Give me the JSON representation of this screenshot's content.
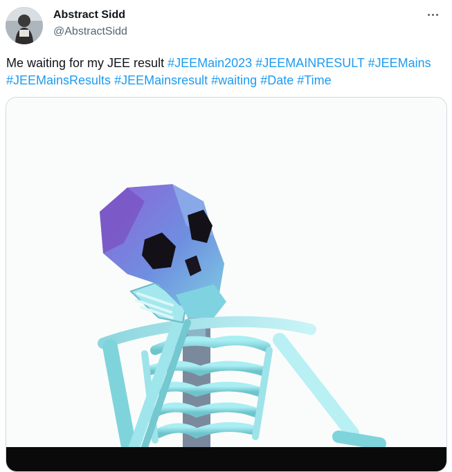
{
  "author": {
    "display_name": "Abstract Sidd",
    "handle": "@AbstractSidd"
  },
  "tweet": {
    "segments": [
      {
        "text": "Me waiting for my JEE result ",
        "type": "text"
      },
      {
        "text": "#JEEMain2023",
        "type": "hashtag"
      },
      {
        "text": " ",
        "type": "text"
      },
      {
        "text": "#JEEMAINRESULT",
        "type": "hashtag"
      },
      {
        "text": " ",
        "type": "text"
      },
      {
        "text": "#JEEMains",
        "type": "hashtag"
      },
      {
        "text": " ",
        "type": "text"
      },
      {
        "text": "#JEEMainsResults",
        "type": "hashtag"
      },
      {
        "text": " ",
        "type": "text"
      },
      {
        "text": "#JEEMainsresult",
        "type": "hashtag"
      },
      {
        "text": " ",
        "type": "text"
      },
      {
        "text": "#waiting",
        "type": "hashtag"
      },
      {
        "text": " ",
        "type": "text"
      },
      {
        "text": "#Date",
        "type": "hashtag"
      },
      {
        "text": " ",
        "type": "text"
      },
      {
        "text": "#Time",
        "type": "hashtag"
      }
    ]
  },
  "icons": {
    "more": "more-options-icon"
  },
  "colors": {
    "hashtag": "#1d9bf0",
    "secondary_text": "#536471",
    "border": "#cfd9de"
  }
}
